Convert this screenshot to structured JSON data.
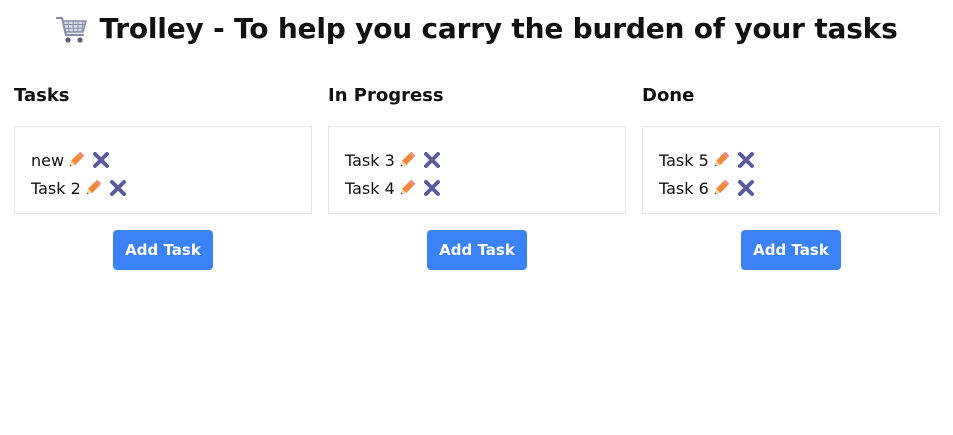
{
  "header": {
    "icon": "shopping-cart-icon",
    "title": "Trolley - To help you carry the burden of your tasks"
  },
  "columns": [
    {
      "title": "Tasks",
      "tasks": [
        {
          "label": "new",
          "edit_icon": "pencil-icon",
          "delete_icon": "close-icon"
        },
        {
          "label": "Task 2",
          "edit_icon": "pencil-icon",
          "delete_icon": "close-icon"
        }
      ],
      "add_button": "Add Task"
    },
    {
      "title": "In Progress",
      "tasks": [
        {
          "label": "Task 3",
          "edit_icon": "pencil-icon",
          "delete_icon": "close-icon"
        },
        {
          "label": "Task 4",
          "edit_icon": "pencil-icon",
          "delete_icon": "close-icon"
        }
      ],
      "add_button": "Add Task"
    },
    {
      "title": "Done",
      "tasks": [
        {
          "label": "Task 5",
          "edit_icon": "pencil-icon",
          "delete_icon": "close-icon"
        },
        {
          "label": "Task 6",
          "edit_icon": "pencil-icon",
          "delete_icon": "close-icon"
        }
      ],
      "add_button": "Add Task"
    }
  ],
  "colors": {
    "accent": "#3b82f6",
    "delete_icon": "#5b5b9b",
    "pencil_body": "#f0883e",
    "border": "#e6e6e6"
  }
}
